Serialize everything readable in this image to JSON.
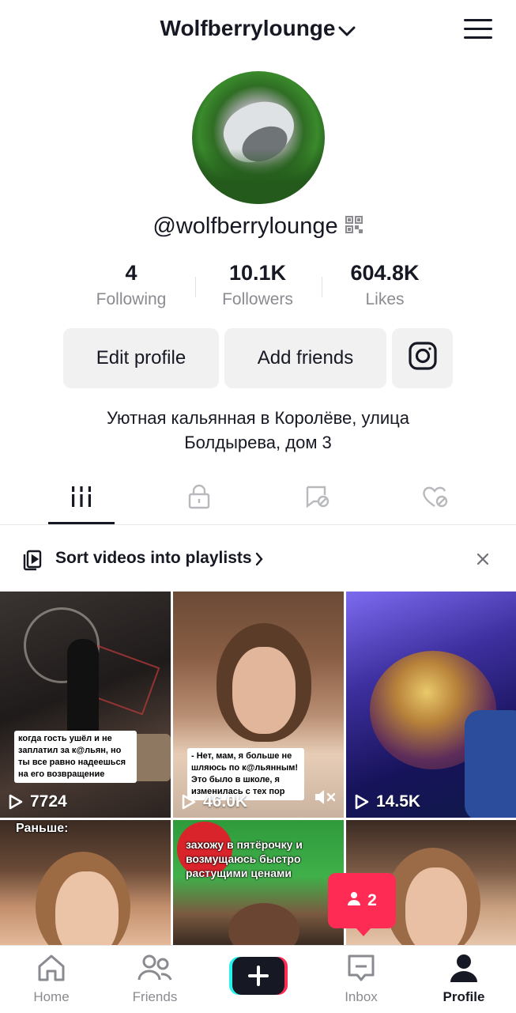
{
  "header": {
    "title": "Wolfberrylounge",
    "menu_icon": "hamburger-icon"
  },
  "profile": {
    "handle": "@wolfberrylounge",
    "stats": [
      {
        "value": "4",
        "label": "Following"
      },
      {
        "value": "10.1K",
        "label": "Followers"
      },
      {
        "value": "604.8K",
        "label": "Likes"
      }
    ],
    "buttons": {
      "edit": "Edit profile",
      "add_friends": "Add friends",
      "instagram_icon": "instagram-icon"
    },
    "bio_line1": "Уютная кальянная в Королёве, улица",
    "bio_line2": "Болдырева, дом 3"
  },
  "tabs": [
    {
      "icon": "videos-grid-icon",
      "active": true
    },
    {
      "icon": "lock-icon",
      "active": false
    },
    {
      "icon": "reposts-hidden-icon",
      "active": false
    },
    {
      "icon": "liked-hidden-icon",
      "active": false
    }
  ],
  "playlist_banner": {
    "text": "Sort videos into playlists"
  },
  "videos": [
    {
      "caption": "когда гость ушёл и не заплатил за к@льян, но ты все равно надеешься на его возвращение",
      "views": "7724"
    },
    {
      "caption": "- Нет, мам, я больше не шляюсь по к@льянным! Это было в школе, я изменилась с тех пор",
      "views": "46.0K"
    },
    {
      "caption": "",
      "views": "14.5K"
    },
    {
      "caption": "Раньше:",
      "views": ""
    },
    {
      "caption": "захожу в пятёрочку и возмущаюсь быстро растущими ценами",
      "views": ""
    },
    {
      "caption": "",
      "views": ""
    }
  ],
  "notification": {
    "count": "2"
  },
  "bottom_nav": [
    {
      "label": "Home",
      "icon": "home-icon"
    },
    {
      "label": "Friends",
      "icon": "friends-icon"
    },
    {
      "label": "",
      "icon": "plus-icon"
    },
    {
      "label": "Inbox",
      "icon": "inbox-icon"
    },
    {
      "label": "Profile",
      "icon": "profile-icon"
    }
  ],
  "colors": {
    "accent": "#fe2c55",
    "text": "#161823",
    "muted": "#8a8b91",
    "button_bg": "#f1f1f2"
  }
}
